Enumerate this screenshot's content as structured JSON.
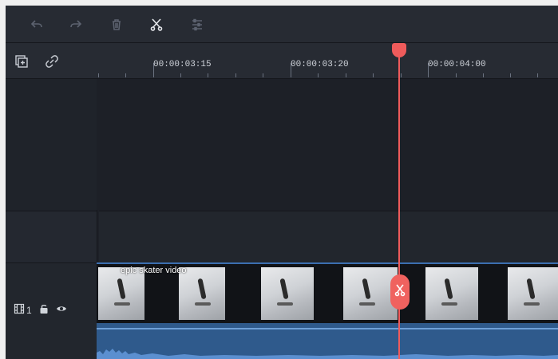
{
  "toolbar": {
    "tools": [
      {
        "icon": "undo-icon"
      },
      {
        "icon": "redo-icon"
      },
      {
        "icon": "delete-icon"
      },
      {
        "icon": "cut-icon"
      },
      {
        "icon": "adjust-icon"
      }
    ]
  },
  "ruler": {
    "labels": [
      "00:00:03:15",
      "00:00:03:20",
      "00:00:04:00"
    ],
    "icons": [
      "add-track-icon",
      "link-icon"
    ]
  },
  "video_track": {
    "number": "1",
    "clip_title": "epic skater video",
    "icons": [
      "film-icon",
      "lock-icon",
      "eye-icon"
    ]
  },
  "playhead": {
    "button_icon": "scissors-icon"
  },
  "colors": {
    "accent": "#ef5b5b",
    "audio": "#2f5a8c",
    "clip_border": "#3c6fb0"
  }
}
